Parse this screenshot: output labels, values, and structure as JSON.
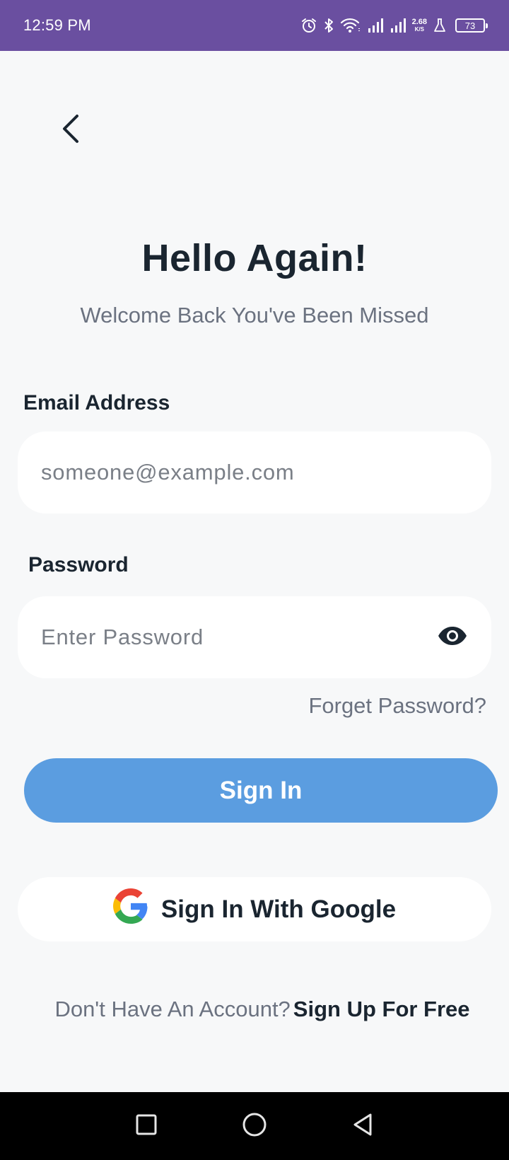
{
  "status_bar": {
    "time": "12:59 PM",
    "network_speed_value": "2.68",
    "network_speed_unit": "K/S",
    "battery_level": "73",
    "icons": [
      "alarm-icon",
      "bluetooth-icon",
      "wifi-icon",
      "signal-icon",
      "signal-icon",
      "lab-icon",
      "battery-icon"
    ]
  },
  "header": {
    "back_icon": "chevron-left-icon",
    "title": "Hello Again!",
    "subtitle": "Welcome Back You've Been Missed"
  },
  "form": {
    "email_label": "Email Address",
    "email_placeholder": "someone@example.com",
    "email_value": "",
    "password_label": "Password",
    "password_placeholder": "Enter Password",
    "password_value": "",
    "password_toggle_icon": "eye-icon",
    "forgot_password": "Forget Password?",
    "sign_in_label": "Sign In",
    "google_label": "Sign In With Google",
    "google_icon": "google-logo-icon"
  },
  "footer": {
    "prompt": "Don't Have An Account?",
    "signup_link": "Sign Up For Free"
  },
  "nav_bar": {
    "buttons": [
      "recents-square-icon",
      "home-circle-icon",
      "back-triangle-icon"
    ]
  },
  "colors": {
    "status_bar": "#6a4fa0",
    "background": "#f7f8f9",
    "primary_button": "#5b9de0",
    "text_dark": "#1a2530",
    "text_muted": "#6b7280"
  }
}
